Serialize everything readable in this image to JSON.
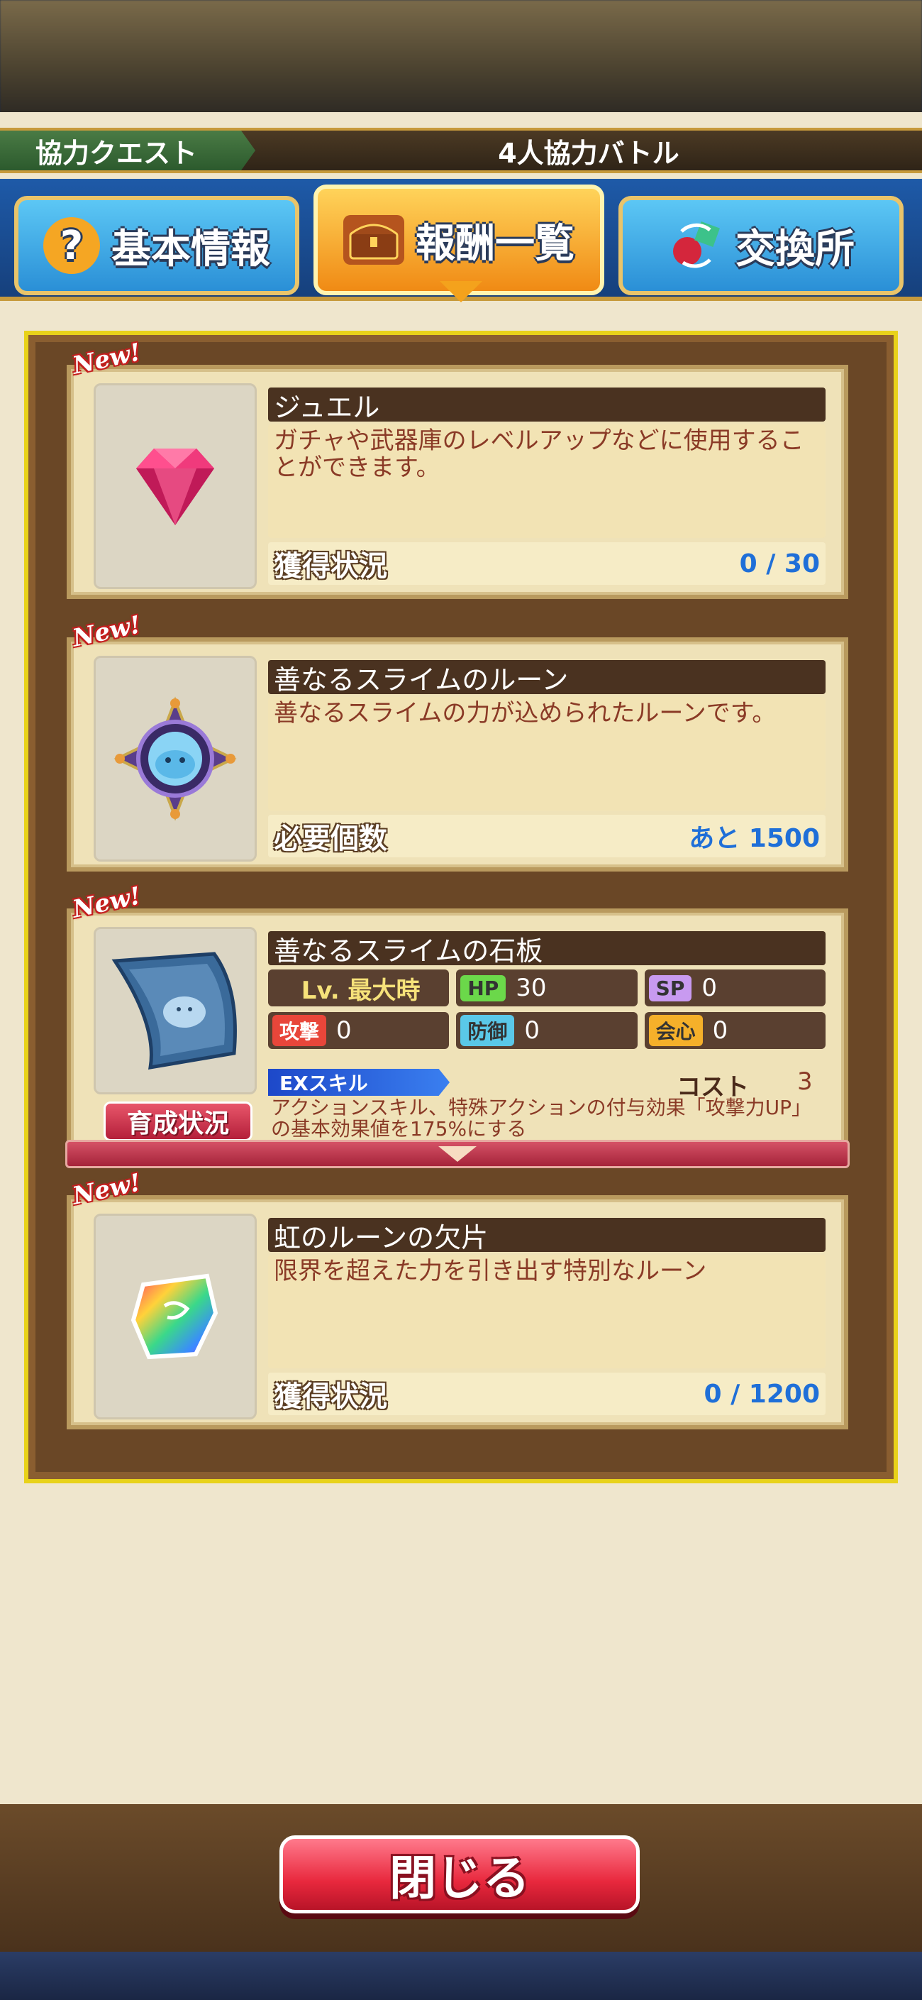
{
  "header": {
    "category": "協力クエスト",
    "title": "4人協力バトル"
  },
  "tabs": [
    {
      "label": "基本情報",
      "icon": "question-icon"
    },
    {
      "label": "報酬一覧",
      "icon": "treasure-chest-icon",
      "active": true
    },
    {
      "label": "交換所",
      "icon": "exchange-icon"
    }
  ],
  "rewards": [
    {
      "badge": "New!",
      "name": "ジュエル",
      "description": "ガチャや武器庫のレベルアップなどに使用することができます。",
      "status_label": "獲得状況",
      "status_value": "0 / 30",
      "icon": "pink-gem-icon"
    },
    {
      "badge": "New!",
      "name": "善なるスライムのルーン",
      "description": "善なるスライムの力が込められたルーンです。",
      "status_label": "必要個数",
      "status_value": "あと 1500",
      "icon": "slime-rune-icon"
    },
    {
      "badge": "New!",
      "name": "善なるスライムの石板",
      "icon": "slime-tablet-icon",
      "level": "Lv. 最大時",
      "stats": {
        "hp_tag": "HP",
        "hp": "30",
        "sp_tag": "SP",
        "sp": "0",
        "atk_tag": "攻撃",
        "atk": "0",
        "def_tag": "防御",
        "def": "0",
        "crit_tag": "会心",
        "crit": "0"
      },
      "ex_label": "EXスキル",
      "cost_label": "コスト",
      "cost_value": "3",
      "skill_description": "アクションスキル、特殊アクションの付与効果「攻撃力UP」の基本効果値を175%にする",
      "grow_button": "育成状況"
    },
    {
      "badge": "New!",
      "name": "虹のルーンの欠片",
      "description": "限界を超えた力を引き出す特別なルーン",
      "status_label": "獲得状況",
      "status_value": "0 / 1200",
      "icon": "rainbow-rune-shard-icon"
    }
  ],
  "close_button": "閉じる",
  "colors": {
    "accent_blue": "#1f6fd8",
    "header_green": "#2c5a2d",
    "close_red": "#e8283d"
  }
}
